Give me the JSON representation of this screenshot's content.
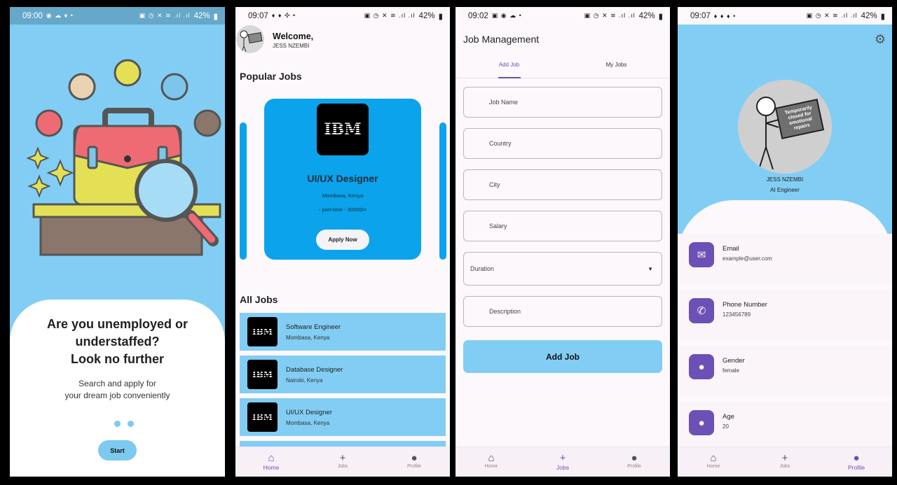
{
  "phone1": {
    "time": "09:00",
    "battery": "42%",
    "headline_1": "Are you unemployed or",
    "headline_2": "understaffed?",
    "headline_3": "Look no further",
    "sub_1": "Search and apply for",
    "sub_2": "your dream job conveniently",
    "start_label": "Start"
  },
  "phone2": {
    "time": "09:07",
    "battery": "42%",
    "welcome": "Welcome,",
    "user": "JESS NZEMBI",
    "popular_title": "Popular Jobs",
    "featured": {
      "logo": "IBM",
      "title": "UI/UX Designer",
      "location": "Mombasa, Kenya",
      "meta": "- part-time  - 30000/=",
      "apply_label": "Apply Now"
    },
    "all_title": "All Jobs",
    "jobs": [
      {
        "logo": "IBM",
        "title": "Software Engineer",
        "location": "Mombasa, Kenya"
      },
      {
        "logo": "IBM",
        "title": "Database Designer",
        "location": "Nairobi, Kenya"
      },
      {
        "logo": "IBM",
        "title": "UI/UX Designer",
        "location": "Mombasa, Kenya"
      }
    ],
    "nav": {
      "home": "Home",
      "jobs": "Jobs",
      "profile": "Profile"
    }
  },
  "phone3": {
    "time": "09:02",
    "battery": "42%",
    "title": "Job Management",
    "tab_add": "Add Job",
    "tab_my": "My Jobs",
    "fields": {
      "job_name": "Job Name",
      "country": "Country",
      "city": "City",
      "salary": "Salary",
      "duration": "Duration",
      "description": "Description"
    },
    "add_button": "Add Job",
    "nav": {
      "home": "Home",
      "jobs": "Jobs",
      "profile": "Profile"
    }
  },
  "phone4": {
    "time": "09:07",
    "battery": "42%",
    "sign_text": "Temporarily closed for emotional repairs",
    "name": "JESS NZEMBI",
    "role": "AI Engineer",
    "rows": [
      {
        "key": "Email",
        "value": "example@user.com",
        "icon": "mail-icon"
      },
      {
        "key": "Phone Number",
        "value": "123456789",
        "icon": "phone-icon"
      },
      {
        "key": "Gender",
        "value": "female",
        "icon": "person-icon"
      },
      {
        "key": "Age",
        "value": "20",
        "icon": "person-icon"
      }
    ],
    "nav": {
      "home": "Home",
      "jobs": "Jobs",
      "profile": "Profile"
    }
  },
  "colors": {
    "accent": "#6a4fb3",
    "sky": "#82cdf4",
    "feature_blue": "#0aa3ec"
  }
}
